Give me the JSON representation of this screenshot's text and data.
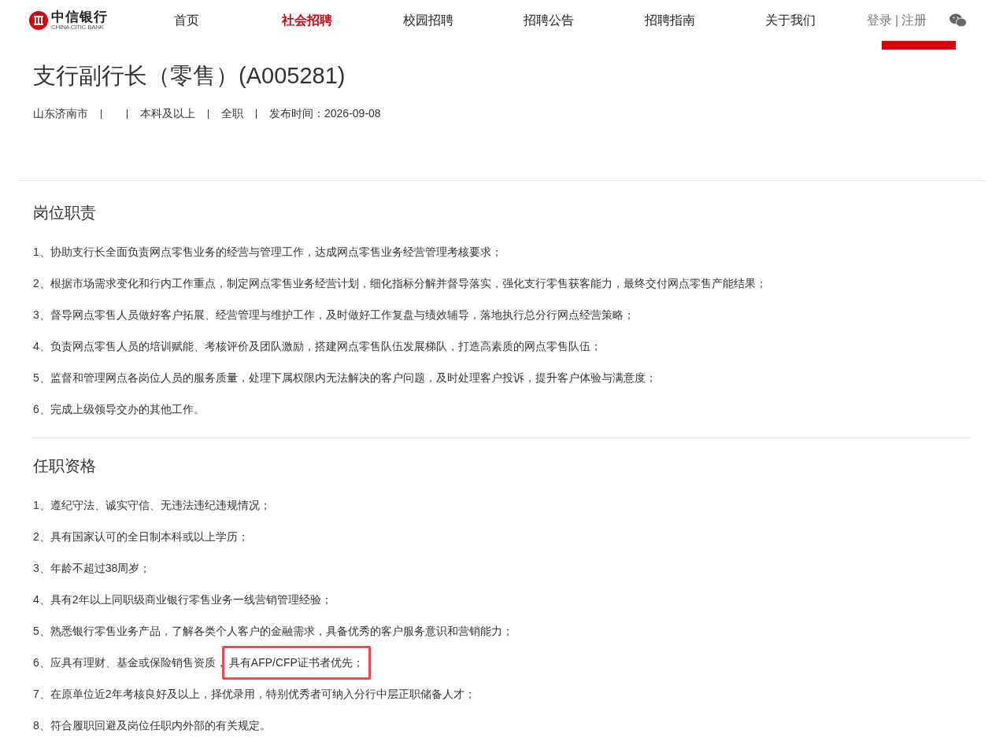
{
  "header": {
    "logo": {
      "name": "中信银行",
      "subtitle": "CHINA CITIC BANK"
    },
    "nav": [
      {
        "label": "首页",
        "selected": false
      },
      {
        "label": "社会招聘",
        "selected": true
      },
      {
        "label": "校园招聘",
        "selected": false
      },
      {
        "label": "招聘公告",
        "selected": false
      },
      {
        "label": "招聘指南",
        "selected": false
      },
      {
        "label": "关于我们",
        "selected": false
      }
    ],
    "login": "登录",
    "separator": "|",
    "register": "注册"
  },
  "job": {
    "title": "支行副行长（零售）(A005281)",
    "meta": [
      "山东济南市",
      "本科及以上",
      "全职",
      "发布时间：2026-09-08"
    ]
  },
  "sections": [
    {
      "heading": "岗位职责",
      "items": [
        {
          "text": "1、协助支行长全面负责网点零售业务的经营与管理工作，达成网点零售业务经营管理考核要求；"
        },
        {
          "text": "2、根据市场需求变化和行内工作重点，制定网点零售业务经营计划，细化指标分解并督导落实，强化支行零售获客能力，最终交付网点零售产能结果；"
        },
        {
          "text": "3、督导网点零售人员做好客户拓展、经营管理与维护工作，及时做好工作复盘与绩效辅导，落地执行总分行网点经营策略；"
        },
        {
          "text": "4、负责网点零售人员的培训赋能、考核评价及团队激励，搭建网点零售队伍发展梯队，打造高素质的网点零售队伍；"
        },
        {
          "text": "5、监督和管理网点各岗位人员的服务质量，处理下属权限内无法解决的客户问题，及时处理客户投诉，提升客户体验与满意度；"
        },
        {
          "text": "6、完成上级领导交办的其他工作。"
        }
      ]
    },
    {
      "heading": "任职资格",
      "items": [
        {
          "text": "1、遵纪守法、诚实守信、无违法违纪违规情况；"
        },
        {
          "text": "2、具有国家认可的全日制本科或以上学历；"
        },
        {
          "text": "3、年龄不超过38周岁；"
        },
        {
          "text": "4、具有2年以上同职级商业银行零售业务一线营销管理经验；"
        },
        {
          "text": "5、熟悉银行零售业务产品，了解各类个人客户的金融需求，具备优秀的客户服务意识和营销能力；"
        },
        {
          "text": "6、应具有理财、基金或保险销售资质，",
          "highlight": "具有AFP/CFP证书者优先；"
        },
        {
          "text": "7、在原单位近2年考核良好及以上，择优录用，特别优秀者可纳入分行中层正职储备人才；"
        },
        {
          "text": "8、符合履职回避及岗位任职内外部的有关规定。"
        }
      ]
    }
  ]
}
